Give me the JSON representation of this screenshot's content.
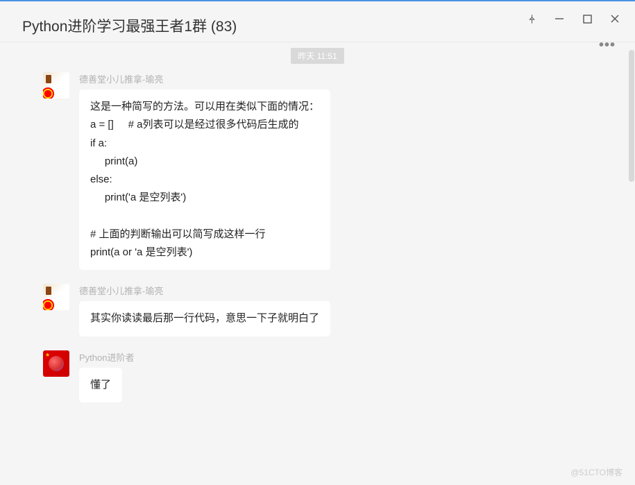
{
  "titlebar": {
    "title": "Python进阶学习最强王者1群 (83)"
  },
  "timestamp": "昨天 11:51",
  "messages": [
    {
      "sender": "德善堂小儿推拿-瑜亮",
      "avatar": "avatar-1",
      "text": "这是一种简写的方法。可以用在类似下面的情况：\na = []     # a列表可以是经过很多代码后生成的\nif a:\n     print(a)\nelse:\n     print('a 是空列表')\n\n# 上面的判断输出可以简写成这样一行\nprint(a or 'a 是空列表')"
    },
    {
      "sender": "德善堂小儿推拿-瑜亮",
      "avatar": "avatar-1",
      "text": "其实你读读最后那一行代码，意思一下子就明白了"
    },
    {
      "sender": "Python进阶者",
      "avatar": "avatar-2",
      "text": "懂了"
    }
  ],
  "watermark": "@51CTO博客"
}
